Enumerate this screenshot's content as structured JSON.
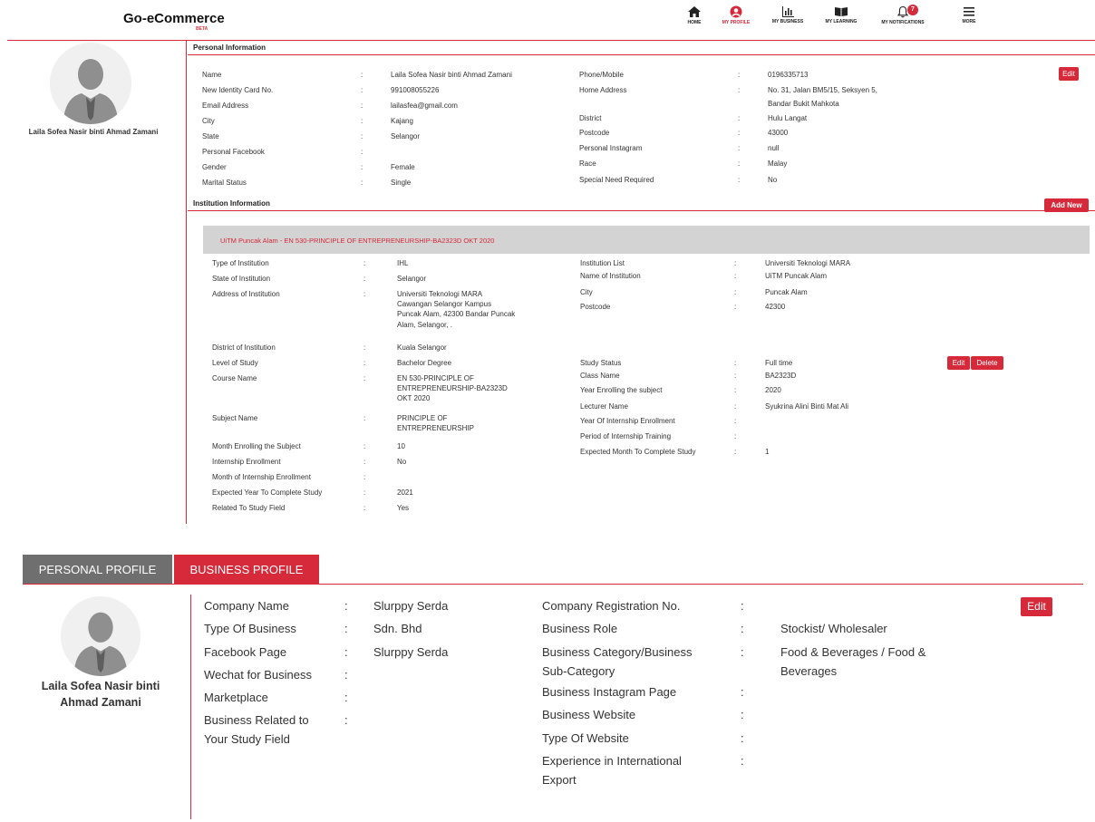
{
  "header": {
    "brand": "Go-eCommerce",
    "beta": "BETA",
    "nav": [
      {
        "label": "HOME"
      },
      {
        "label": "MY PROFILE"
      },
      {
        "label": "MY BUSINESS"
      },
      {
        "label": "MY LEARNING"
      },
      {
        "label": "MY NOTIFICATIONS"
      },
      {
        "label": "MORE"
      }
    ],
    "notification_count": "7"
  },
  "colors": {
    "accent": "#d6293a",
    "tab_inactive": "#6f6f6f",
    "section_bar": "#d3d3d3"
  },
  "profile": {
    "name": "Laila Sofea Nasir binti Ahmad Zamani"
  },
  "personal": {
    "title": "Personal Information",
    "edit": "Edit",
    "left": [
      {
        "label": "Name",
        "value": "Laila Sofea Nasir binti Ahmad Zamani"
      },
      {
        "label": "New Identity Card No.",
        "value": "991008055226"
      },
      {
        "label": "Email Address",
        "value": "lailasfea@gmail.com"
      },
      {
        "label": "City",
        "value": "Kajang"
      },
      {
        "label": "State",
        "value": "Selangor"
      },
      {
        "label": "Personal Facebook",
        "value": ""
      },
      {
        "label": "Gender",
        "value": "Female"
      },
      {
        "label": "Marital Status",
        "value": "Single"
      }
    ],
    "right": [
      {
        "label": "Phone/Mobile",
        "value": "0196335713"
      },
      {
        "label": "Home Address",
        "value": "No. 31, Jalan BM5/15, Seksyen 5,"
      },
      {
        "label": "",
        "value": "Bandar Bukit Mahkota"
      },
      {
        "label": "District",
        "value": "Hulu Langat"
      },
      {
        "label": "Postcode",
        "value": "43000"
      },
      {
        "label": "Personal Instagram",
        "value": "null"
      },
      {
        "label": "Race",
        "value": "Malay"
      },
      {
        "label": "Special Need Required",
        "value": "No"
      }
    ]
  },
  "institution": {
    "title": "Institution Information",
    "add_new": "Add New",
    "bar_title": "UiTM Puncak Alam - EN 530-PRINCIPLE OF ENTREPRENEURSHIP-BA2323D OKT 2020",
    "edit": "Edit",
    "delete": "Delete",
    "left": [
      {
        "label": "Type of Institution",
        "value": "IHL"
      },
      {
        "label": "State of Institution",
        "value": "Selangor"
      },
      {
        "label": "Address of Institution",
        "value": "Universiti Teknologi MARA\nCawangan Selangor Kampus\nPuncak Alam, 42300 Bandar Puncak\nAlam, Selangor, ."
      },
      {
        "label": "District of Institution",
        "value": "Kuala Selangor"
      },
      {
        "label": "Level of Study",
        "value": "Bachelor Degree"
      },
      {
        "label": "Course Name",
        "value": "EN 530-PRINCIPLE OF\nENTREPRENEURSHIP-BA2323D\nOKT 2020"
      },
      {
        "label": "Subject Name",
        "value": "PRINCIPLE OF\nENTREPRENEURSHIP"
      },
      {
        "label": "Month Enrolling the Subject",
        "value": "10"
      },
      {
        "label": "Internship Enrollment",
        "value": "No"
      },
      {
        "label": "Month of Internship Enrollment",
        "value": ""
      },
      {
        "label": "Expected Year To Complete Study",
        "value": "2021"
      },
      {
        "label": "Related To Study Field",
        "value": "Yes"
      }
    ],
    "right": [
      {
        "label": "Institution List",
        "value": "Universiti Teknologi MARA"
      },
      {
        "label": "Name of Institution",
        "value": "UiTM Puncak Alam"
      },
      {
        "label": "City",
        "value": "Puncak Alam"
      },
      {
        "label": "Postcode",
        "value": "42300"
      },
      {
        "label": "Study Status",
        "value": "Full time"
      },
      {
        "label": "Class Name",
        "value": "BA2323D"
      },
      {
        "label": "Year Enrolling the subject",
        "value": "2020"
      },
      {
        "label": "Lecturer Name",
        "value": "Syukrina Alini Binti Mat Ali"
      },
      {
        "label": "Year Of Internship Enrollment",
        "value": ""
      },
      {
        "label": "Period of Internship Training",
        "value": ""
      },
      {
        "label": "Expected Month To Complete Study",
        "value": "1"
      }
    ]
  },
  "tabs": {
    "personal": "PERSONAL PROFILE",
    "business": "BUSINESS PROFILE"
  },
  "business": {
    "name_line1": "Laila Sofea Nasir binti",
    "name_line2": "Ahmad Zamani",
    "edit": "Edit",
    "left": [
      {
        "label": "Company Name",
        "value": "Slurppy Serda"
      },
      {
        "label": "Type Of Business",
        "value": "Sdn. Bhd"
      },
      {
        "label": "Facebook Page",
        "value": "Slurppy Serda"
      },
      {
        "label": "Wechat for Business",
        "value": ""
      },
      {
        "label": "Marketplace",
        "value": ""
      },
      {
        "label": "Business Related to\nYour Study Field",
        "value": ""
      }
    ],
    "right": [
      {
        "label": "Company Registration No.",
        "value": ""
      },
      {
        "label": "Business Role",
        "value": "Stockist/ Wholesaler"
      },
      {
        "label": "Business Category/Business\nSub-Category",
        "value": "Food & Beverages / Food &\nBeverages"
      },
      {
        "label": "Business Instagram Page",
        "value": ""
      },
      {
        "label": "Business Website",
        "value": ""
      },
      {
        "label": "Type Of Website",
        "value": ""
      },
      {
        "label": "Experience in International\nExport",
        "value": ""
      }
    ]
  }
}
